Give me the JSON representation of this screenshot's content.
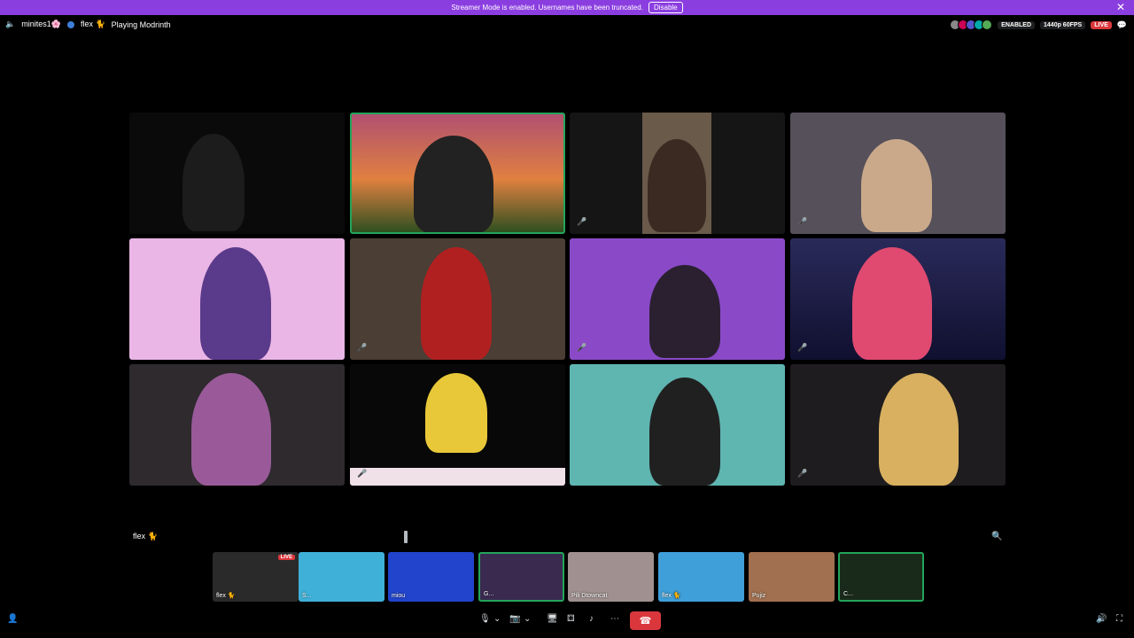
{
  "banner": {
    "text": "Streamer Mode is enabled. Usernames have been truncated.",
    "disable_label": "Disable",
    "close_glyph": "✕"
  },
  "topbar": {
    "server_name": "minites1🌸",
    "user_name": "flex 🐈",
    "activity": "Playing Modrinth",
    "enabled_label": "ENABLED",
    "quality_label": "1440p 60FPS",
    "live_label": "LIVE"
  },
  "grid_tiles": [
    {
      "id": "tile-1",
      "bg": "#0c0c0c",
      "speaking": false
    },
    {
      "id": "tile-2",
      "bg": "#7a4a6a",
      "speaking": true
    },
    {
      "id": "tile-3",
      "bg": "#2a2622",
      "speaking": false
    },
    {
      "id": "tile-4",
      "bg": "#4a4550",
      "speaking": false
    },
    {
      "id": "tile-5",
      "bg": "#e8b8e8",
      "speaking": false
    },
    {
      "id": "tile-6",
      "bg": "#3a3330",
      "speaking": false
    },
    {
      "id": "tile-7",
      "bg": "#8a4ac8",
      "speaking": false
    },
    {
      "id": "tile-8",
      "bg": "#1a1a3a",
      "speaking": false
    },
    {
      "id": "tile-9",
      "bg": "#2e2a2e",
      "speaking": false
    },
    {
      "id": "tile-10",
      "bg": "#080808",
      "speaking": false
    },
    {
      "id": "tile-11",
      "bg": "#5fb5b0",
      "speaking": false
    },
    {
      "id": "tile-12",
      "bg": "#1e1c1e",
      "speaking": false
    }
  ],
  "self_label": "flex 🐈",
  "strip": [
    {
      "name": "flex 🐈",
      "bg": "#2a2a2a",
      "live": "LIVE"
    },
    {
      "name": "S...",
      "bg": "#3fb0d8"
    },
    {
      "name": "miou",
      "bg": "#2244cc"
    },
    {
      "name": "G...",
      "bg": "#3a2a50"
    },
    {
      "name": "Pili Dtowncat",
      "bg": "#a09090"
    },
    {
      "name": "flex 🐈",
      "bg": "#3f9fd8"
    },
    {
      "name": "Pujiz",
      "bg": "#a07050"
    },
    {
      "name": "C...",
      "bg": "#1a2a1a"
    }
  ]
}
